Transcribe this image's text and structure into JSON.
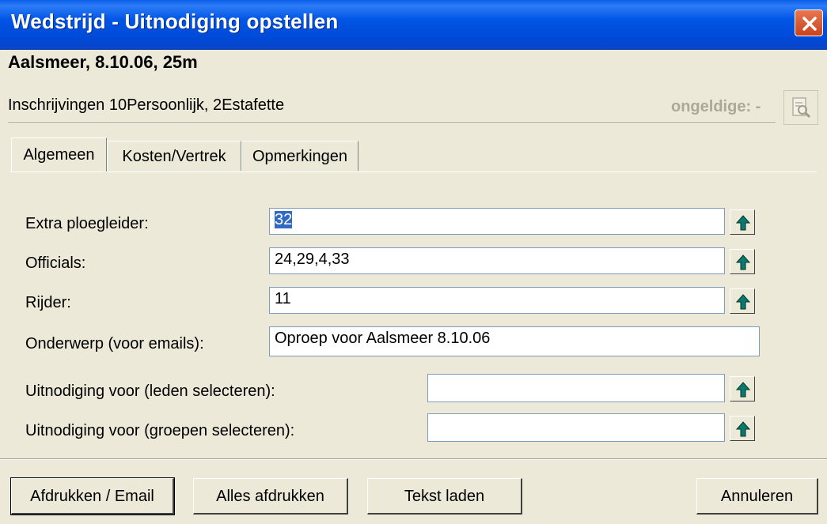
{
  "window": {
    "title": "Wedstrijd - Uitnodiging opstellen",
    "close_icon": "close-icon"
  },
  "header": {
    "meet": "Aalsmeer, 8.10.06, 25m",
    "entries": "Inschrijvingen 10Persoonlijk, 2Estafette",
    "invalid_label": "ongeldige: -",
    "invalid_icon": "search-document-icon"
  },
  "tabs": [
    {
      "label": "Algemeen",
      "active": true
    },
    {
      "label": "Kosten/Vertrek",
      "active": false
    },
    {
      "label": "Opmerkingen",
      "active": false
    }
  ],
  "form": {
    "extra_ploegleider": {
      "label": "Extra ploegleider:",
      "value": "32"
    },
    "officials": {
      "label": "Officials:",
      "value": "24,29,4,33"
    },
    "rijder": {
      "label": "Rijder:",
      "value": "11"
    },
    "onderwerp": {
      "label": "Onderwerp (voor emails):",
      "value": "Oproep voor Aalsmeer 8.10.06"
    },
    "uitnodiging_leden": {
      "label": "Uitnodiging voor (leden selecteren):",
      "value": ""
    },
    "uitnodiging_groepen": {
      "label": "Uitnodiging voor (groepen selecteren):",
      "value": ""
    }
  },
  "buttons": {
    "print_email": "Afdrukken / Email",
    "print_all": "Alles afdrukken",
    "load_text": "Tekst laden",
    "cancel": "Annuleren"
  },
  "colors": {
    "titlebar": "#0055e5",
    "dialog_bg": "#ece9d8",
    "arrow_icon": "#0b7a6e",
    "close_button": "#d8552b"
  }
}
